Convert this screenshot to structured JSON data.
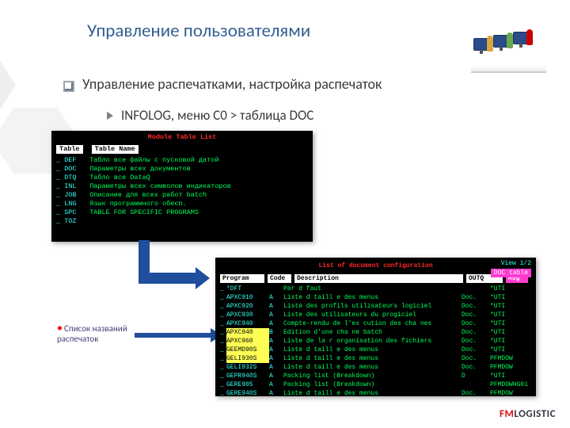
{
  "title": "Управление пользователями",
  "bullet1": "Управление распечатками, настройка распечаток",
  "bullet2": "INFOLOG, меню C0 > таблица DOC",
  "note": "Список названий распечаток",
  "logo": {
    "fm": "FM",
    "rest": "LOGISTIC"
  },
  "term1": {
    "title": "Module Table List",
    "hdr_table": "Table",
    "hdr_name": "Table Name",
    "rows": [
      {
        "code": "DEF",
        "desc": "Табло все файлы с пусковой датой"
      },
      {
        "code": "DOC",
        "desc": "Параметры всех документов"
      },
      {
        "code": "DTQ",
        "desc": "Табло все DataQ"
      },
      {
        "code": "INL",
        "desc": "Параметры всех символов индикаторов"
      },
      {
        "code": "JOB",
        "desc": "Описание для всех работ batch"
      },
      {
        "code": "LNG",
        "desc": "Язык программного обесп."
      },
      {
        "code": "SPC",
        "desc": "TABLE FOR SPECIFIC PROGRAMS"
      },
      {
        "code": "TOZ",
        "desc": ""
      }
    ]
  },
  "term2": {
    "title": "List of document configuration",
    "view": "View 1/2",
    "tag": "DOC table",
    "hdr": {
      "program": "Program",
      "code": "Code",
      "desc": "Description",
      "outq": "OUTQ",
      "msg": "Msg"
    },
    "rows": [
      {
        "prog": "*DFT",
        "cd": "",
        "desc": "Par d faut",
        "o1": "",
        "o2": "*UTI",
        "hl": false
      },
      {
        "prog": "APXC910",
        "cd": "A",
        "desc": "Liste d taill e des menus",
        "o1": "Doc.",
        "o2": "*UTI",
        "hl": false
      },
      {
        "prog": "APXC920",
        "cd": "A",
        "desc": "Liste des profils utilisateurs logiciel",
        "o1": "Doc.",
        "o2": "*UTI",
        "hl": false
      },
      {
        "prog": "APXC930",
        "cd": "A",
        "desc": "Liste des utilisateurs du progiciel",
        "o1": "Doc.",
        "o2": "*UTI",
        "hl": false
      },
      {
        "prog": "APXC940",
        "cd": "A",
        "desc": "Compte-rendu de l'ex cution des cha nes",
        "o1": "Doc.",
        "o2": "*UTI",
        "hl": false
      },
      {
        "prog": "APXC940",
        "cd": "B",
        "desc": "Edition d'une cha ne batch",
        "o1": "Doc.",
        "o2": "*UTI",
        "hl": true
      },
      {
        "prog": "APXC960",
        "cd": "A",
        "desc": "Liste de la r organisation des fichiers",
        "o1": "Doc.",
        "o2": "*UTI",
        "hl": true
      },
      {
        "prog": "GEEMD90S",
        "cd": "A",
        "desc": "Liste d taill e des menus",
        "o1": "Doc.",
        "o2": "*UTI",
        "hl": true
      },
      {
        "prog": "GELI930S",
        "cd": "A",
        "desc": "Liste d taill e des menus",
        "o1": "Doc.",
        "o2": "PFMDOW",
        "hl": true
      },
      {
        "prog": "GELI932S",
        "cd": "A",
        "desc": "Liste d taill e des menus",
        "o1": "Doc.",
        "o2": "PFMDOW",
        "hl": false
      },
      {
        "prog": "GEPR940S",
        "cd": "A",
        "desc": "Packing list (Breakdown)",
        "o1": "D",
        "o2": "*UTI",
        "hl": false
      },
      {
        "prog": "GERE905",
        "cd": "A",
        "desc": "Packing list (Breakdown)",
        "o1": "",
        "o2": "PFMDOWHG01",
        "hl": false
      },
      {
        "prog": "GERE940S",
        "cd": "A",
        "desc": "Liste d taill e des menus",
        "o1": "Doc.",
        "o2": "PFMDOW",
        "hl": false
      }
    ]
  }
}
